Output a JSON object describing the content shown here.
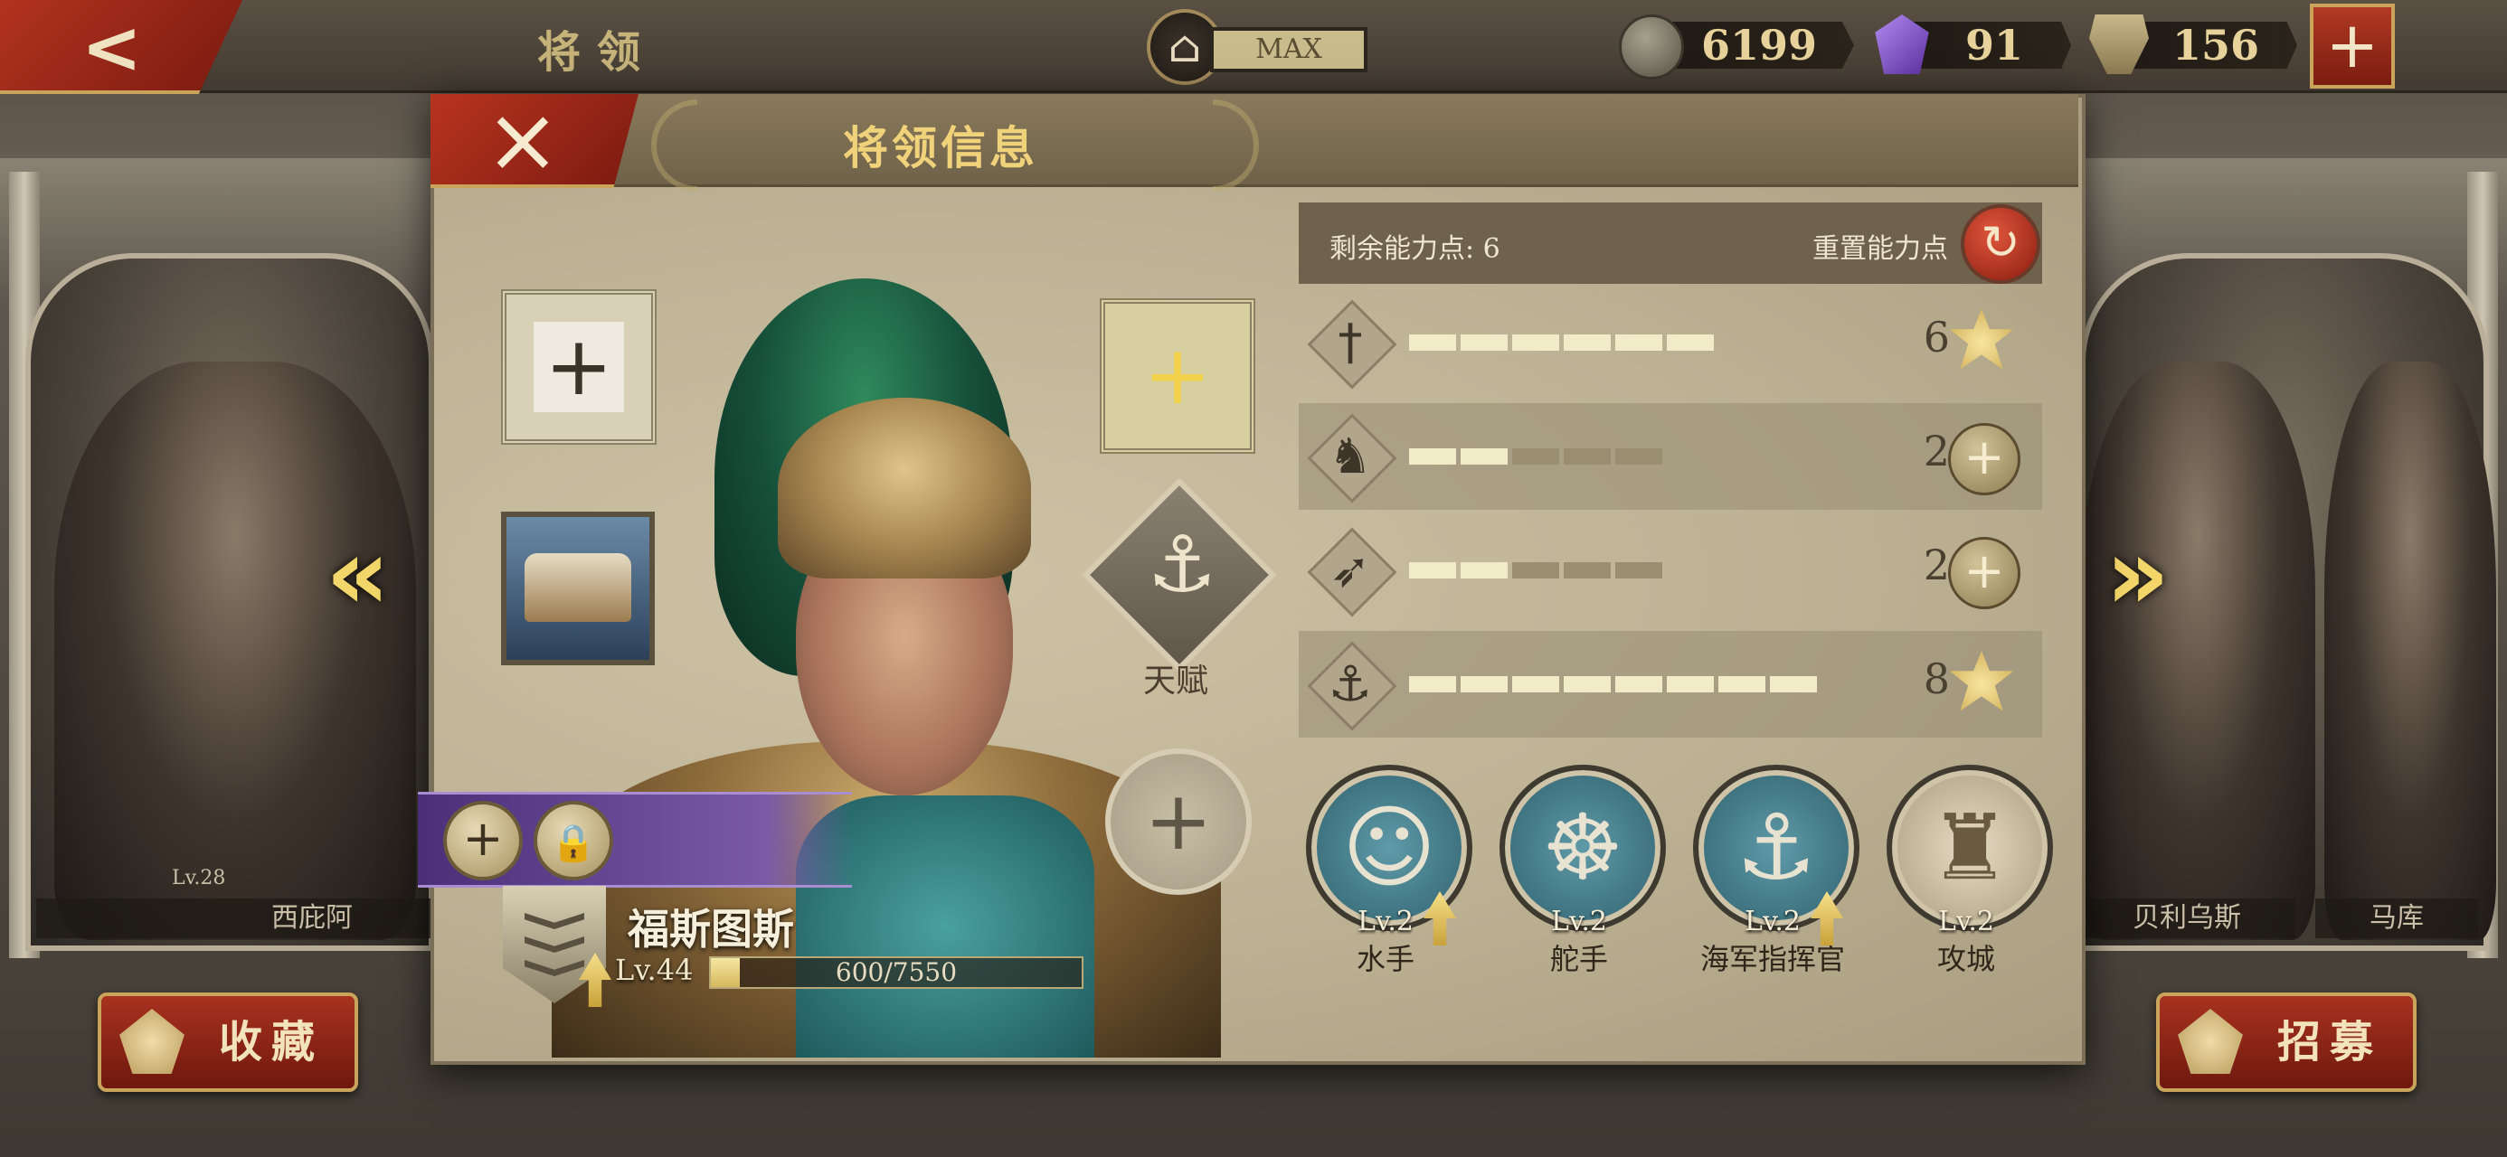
{
  "top_bar": {
    "title": "将领",
    "building_level": "MAX",
    "resources": {
      "coins": "6199",
      "gems": "91",
      "spqr": "156"
    }
  },
  "background_heroes": {
    "left": {
      "level": "Lv.28",
      "name": "西庇阿"
    },
    "right_1": {
      "name": "贝利乌斯"
    },
    "right_2": {
      "name": "马库"
    }
  },
  "bottom": {
    "favorite_label": "收藏",
    "recruit_label": "招募"
  },
  "modal": {
    "title": "将领信息",
    "talent_label": "天赋",
    "hero": {
      "name": "福斯图斯",
      "level": "Lv.44",
      "xp_text": "600/7550",
      "xp_fraction": 0.079
    },
    "points": {
      "remaining_label": "剩余能力点:",
      "remaining_value": "6",
      "reset_label": "重置能力点"
    },
    "stats": [
      {
        "icon": "sword-icon",
        "filled": 6,
        "total": 6,
        "value": "6",
        "action": "star"
      },
      {
        "icon": "horse-icon",
        "filled": 2,
        "total": 5,
        "value": "2",
        "action": "plus"
      },
      {
        "icon": "bow-icon",
        "filled": 2,
        "total": 5,
        "value": "2",
        "action": "plus"
      },
      {
        "icon": "anchor-icon",
        "filled": 8,
        "total": 8,
        "value": "8",
        "action": "star"
      }
    ],
    "skills": [
      {
        "icon": "sailor-icon",
        "level": "Lv.2",
        "name": "水手",
        "upgradable": true
      },
      {
        "icon": "helm-wheel-icon",
        "level": "Lv.2",
        "name": "舵手",
        "upgradable": false
      },
      {
        "icon": "anchor-icon",
        "level": "Lv.2",
        "name": "海军指挥官",
        "upgradable": true
      },
      {
        "icon": "siege-icon",
        "level": "Lv.2",
        "name": "攻城",
        "upgradable": false
      }
    ]
  },
  "colors": {
    "accent_red": "#a8321f",
    "gold_text": "#f0d27a",
    "parchment": "#c4b89b"
  }
}
